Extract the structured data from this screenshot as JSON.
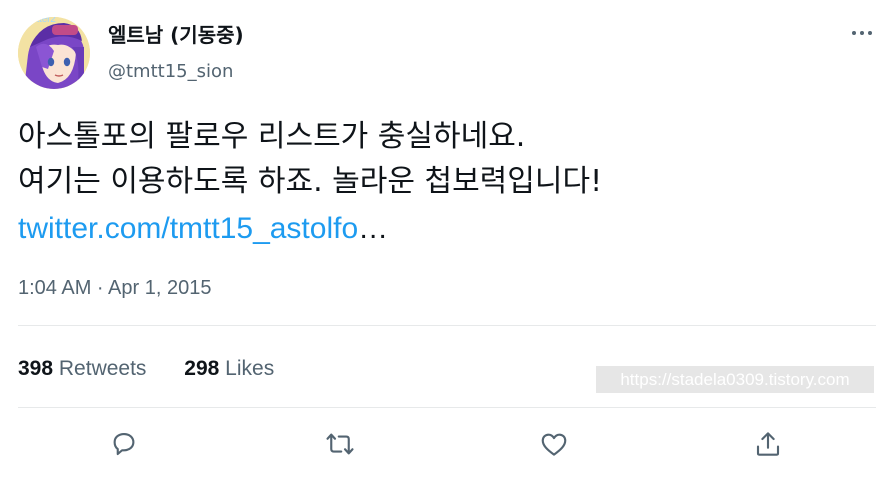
{
  "author": {
    "display_name": "엘트남 (기동중)",
    "handle": "@tmtt15_sion",
    "avatar_tag": "twitter2"
  },
  "tweet": {
    "lines": [
      "아스톨포의 팔로우 리스트가 충실하네요.",
      "여기는 이용하도록 하죠. 놀라운 첩보력입니다!"
    ],
    "link_text": "twitter.com/tmtt15_astolfo",
    "link_ellipsis": "…",
    "timestamp": "1:04 AM · Apr 1, 2015"
  },
  "stats": {
    "retweets_count": "398",
    "retweets_label": "Retweets",
    "likes_count": "298",
    "likes_label": "Likes"
  },
  "watermark": "https://stadela0309.tistory.com",
  "icons": {
    "more": "more-horizontal-icon",
    "reply": "reply-icon",
    "retweet": "retweet-icon",
    "like": "like-icon",
    "share": "share-icon"
  },
  "colors": {
    "link": "#1d9bf0",
    "secondary_text": "#536471",
    "primary_text": "#0f1419",
    "divider": "#e7e9ea"
  }
}
